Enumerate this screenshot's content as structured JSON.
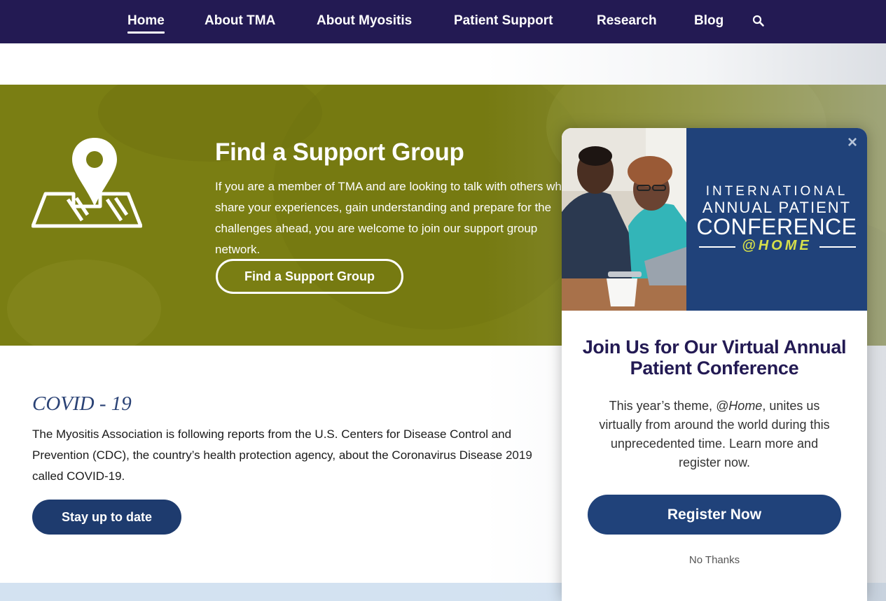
{
  "nav": {
    "items": [
      {
        "label": "Home",
        "active": true
      },
      {
        "label": "About TMA",
        "active": false
      },
      {
        "label": "About Myositis",
        "active": false
      },
      {
        "label": "Patient Support",
        "active": false
      },
      {
        "label": "Research",
        "active": false
      },
      {
        "label": "Blog",
        "active": false
      }
    ],
    "search_icon": "search-icon"
  },
  "hero": {
    "title": "Find a Support Group",
    "description": "If you are a member of TMA and are looking to talk with others who share your experiences, gain understanding and prepare for the challenges ahead, you are welcome to join our support group network.",
    "button_label": "Find a Support Group",
    "icon": "map-pin-icon"
  },
  "covid": {
    "title": "COVID - 19",
    "text": "The Myositis Association is following reports from the U.S. Centers for Disease Control and Prevention (CDC), the country’s health protection agency, about the Coronavirus Disease 2019 called COVID-19.",
    "button_label": "Stay up to date"
  },
  "modal": {
    "close_label": "×",
    "banner": {
      "line1": "INTERNATIONAL",
      "line2": "ANNUAL PATIENT",
      "line3": "CONFERENCE",
      "line4": "@HOME"
    },
    "heading": "Join Us for Our Virtual Annual Patient Conference",
    "body_before": "This year’s theme, ",
    "body_em": "@Home",
    "body_after": ", unites us virtually from around the world during this unprecedented time. Learn more and register now.",
    "register_label": "Register Now",
    "no_thanks_label": "No Thanks"
  },
  "colors": {
    "nav_bg": "#231a53",
    "hero_bg": "#7a7e13",
    "primary_button": "#1e3b6e",
    "banner_bg": "#20427a",
    "banner_accent": "#d7e04a",
    "bottom_band": "#d3e2f1"
  }
}
